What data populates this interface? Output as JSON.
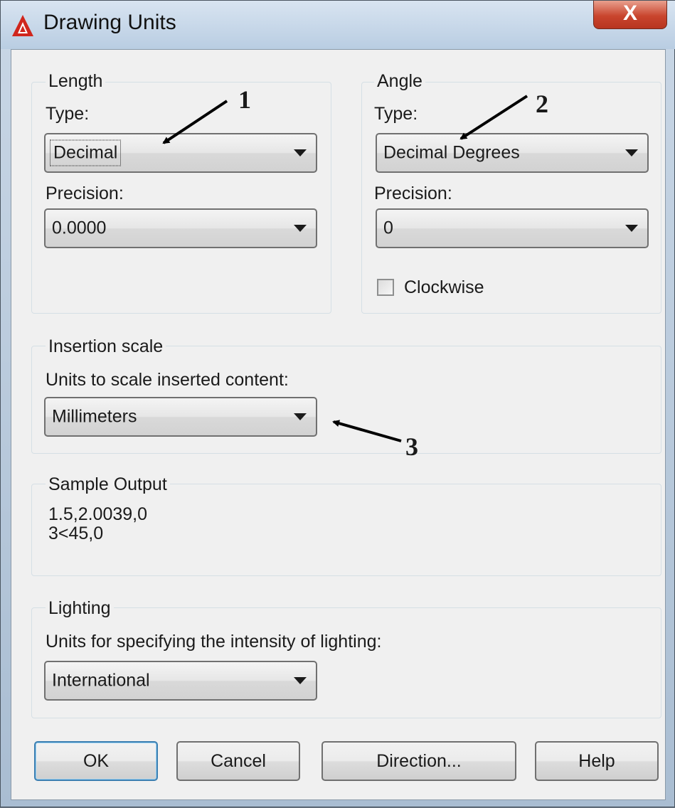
{
  "window": {
    "title": "Drawing Units",
    "close_label": "X"
  },
  "length": {
    "group_label": "Length",
    "type_label": "Type:",
    "type_value": "Decimal",
    "precision_label": "Precision:",
    "precision_value": "0.0000"
  },
  "angle": {
    "group_label": "Angle",
    "type_label": "Type:",
    "type_value": "Decimal Degrees",
    "precision_label": "Precision:",
    "precision_value": "0",
    "clockwise_label": "Clockwise",
    "clockwise_checked": false
  },
  "insertion": {
    "group_label": "Insertion scale",
    "units_label": "Units to scale inserted content:",
    "units_value": "Millimeters"
  },
  "sample": {
    "group_label": "Sample Output",
    "line1": "1.5,2.0039,0",
    "line2": "3<45,0"
  },
  "lighting": {
    "group_label": "Lighting",
    "units_label": "Units for specifying the intensity of lighting:",
    "units_value": "International"
  },
  "buttons": {
    "ok": "OK",
    "cancel": "Cancel",
    "direction": "Direction...",
    "help": "Help"
  },
  "annotations": {
    "a1": "1",
    "a2": "2",
    "a3": "3"
  },
  "colors": {
    "close_red": "#c9452e",
    "default_button_border": "#3c7fb1"
  }
}
